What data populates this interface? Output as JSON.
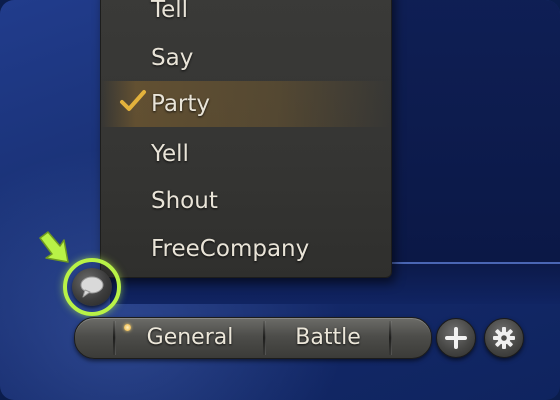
{
  "chat_mode_menu": {
    "items": [
      {
        "label": "Tell",
        "selected": false
      },
      {
        "label": "Say",
        "selected": false
      },
      {
        "label": "Party",
        "selected": true
      },
      {
        "label": "Yell",
        "selected": false
      },
      {
        "label": "Shout",
        "selected": false
      },
      {
        "label": "FreeCompany",
        "selected": false
      }
    ]
  },
  "chat_tabs": {
    "tabs": [
      {
        "label": "General",
        "active": true
      },
      {
        "label": "Battle",
        "active": false
      }
    ]
  },
  "buttons": {
    "chat_mode_icon": "speech-bubble-icon",
    "add_icon": "plus-icon",
    "settings_icon": "gear-icon"
  },
  "colors": {
    "highlight": "#b8f247",
    "menu_background": "#3a3a38",
    "selected_check": "#e3b23c",
    "background_blue": "#1a3277"
  }
}
